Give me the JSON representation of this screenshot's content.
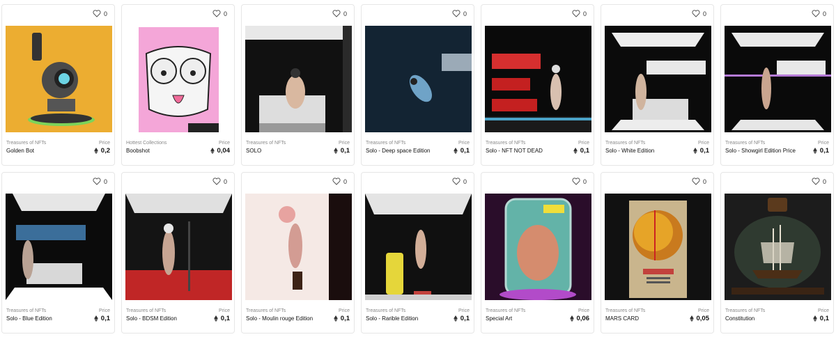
{
  "price_label": "Price",
  "cards": [
    {
      "collection": "Treasures of NFTs",
      "name": "Golden Bot",
      "price": "0,2",
      "likes": "0"
    },
    {
      "collection": "Hottest Collections",
      "name": "Boobshot",
      "price": "0,04",
      "likes": "0"
    },
    {
      "collection": "Treasures of NFTs",
      "name": "SOLO",
      "price": "0,1",
      "likes": "0"
    },
    {
      "collection": "Treasures of NFTs",
      "name": "Solo - Deep space Edition",
      "price": "0,1",
      "likes": "0"
    },
    {
      "collection": "Treasures of NFTs",
      "name": "Solo - NFT NOT DEAD",
      "price": "0,1",
      "likes": "0"
    },
    {
      "collection": "Treasures of NFTs",
      "name": "Solo - White Edition",
      "price": "0,1",
      "likes": "0"
    },
    {
      "collection": "Treasures of NFTs",
      "name": "Solo - Showgirl Edition Price",
      "price": "0,1",
      "likes": "0"
    },
    {
      "collection": "Treasures of NFTs",
      "name": "Solo - Blue Edition",
      "price": "0,1",
      "likes": "0"
    },
    {
      "collection": "Treasures of NFTs",
      "name": "Solo - BDSM Edition",
      "price": "0,1",
      "likes": "0"
    },
    {
      "collection": "Treasures of NFTs",
      "name": "Solo - Moulin rouge Edition",
      "price": "0,1",
      "likes": "0"
    },
    {
      "collection": "Treasures of NFTs",
      "name": "Solo - Rarible Edition",
      "price": "0,1",
      "likes": "0"
    },
    {
      "collection": "Treasures of NFTs",
      "name": "Special Art",
      "price": "0,06",
      "likes": "0"
    },
    {
      "collection": "Treasures of NFTs",
      "name": "MARS CARD",
      "price": "0,05",
      "likes": "0"
    },
    {
      "collection": "Treasures of NFTs",
      "name": "Constitution",
      "price": "0,1",
      "likes": "0"
    }
  ]
}
